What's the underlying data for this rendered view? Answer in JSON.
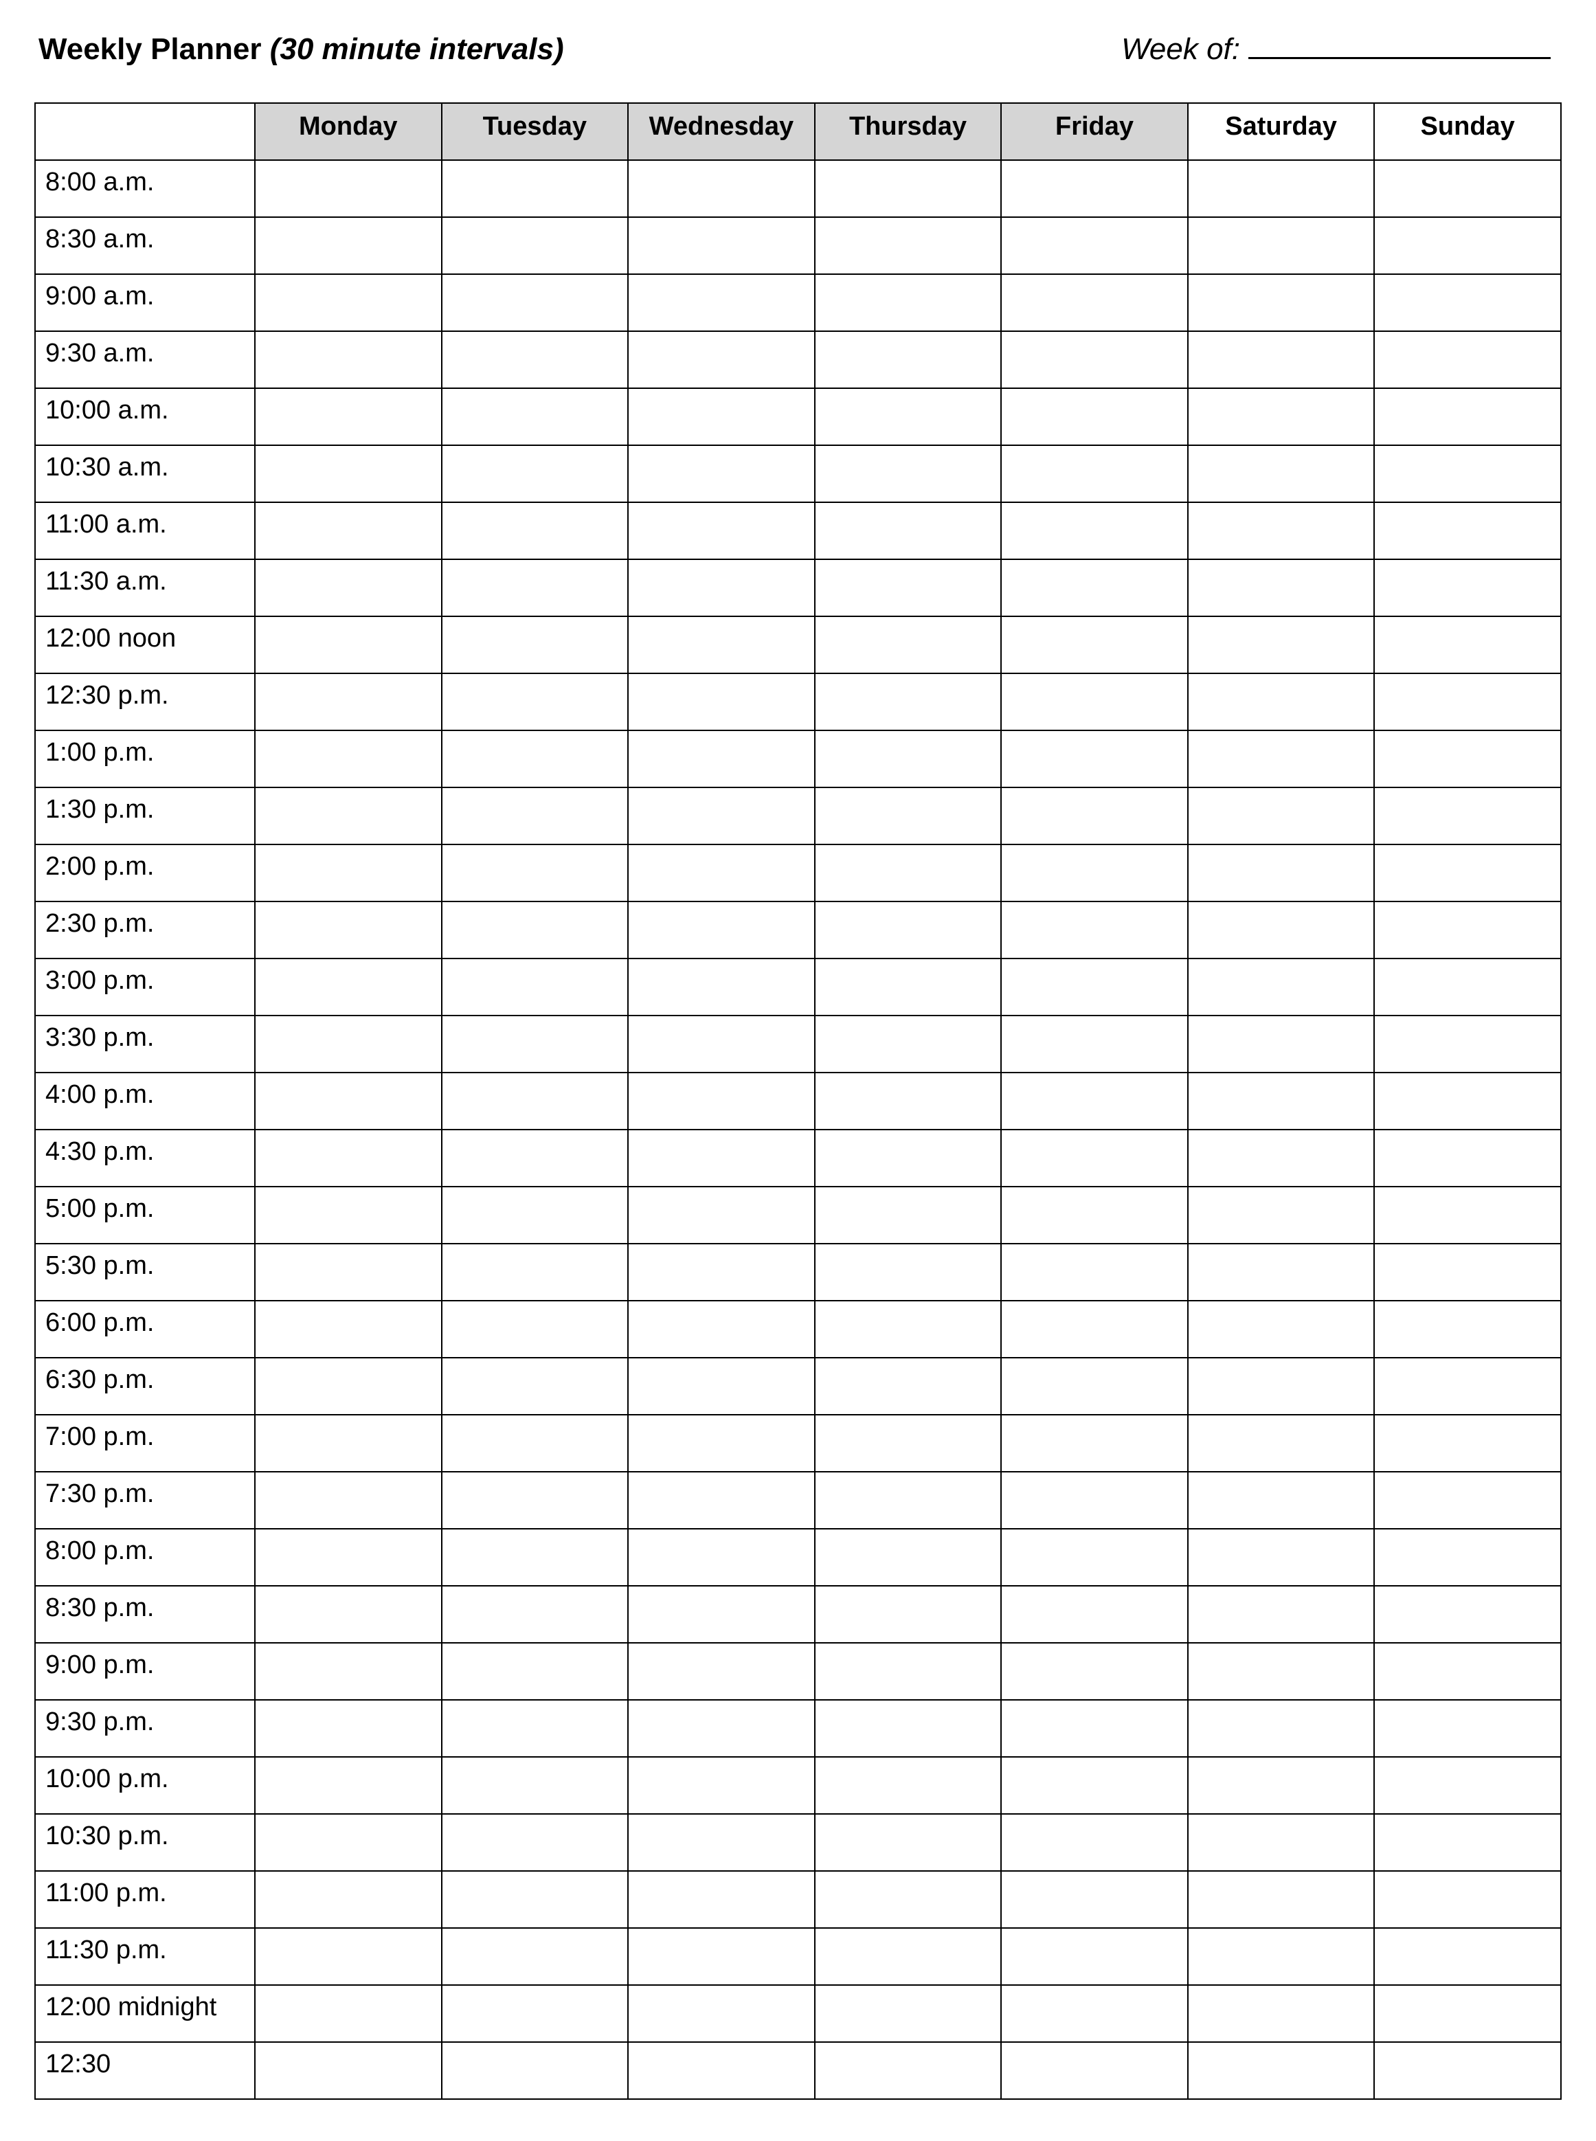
{
  "header": {
    "title_bold": "Weekly Planner",
    "title_italic": "(30 minute intervals)",
    "week_of_label": "Week of:",
    "week_of_value": ""
  },
  "columns": [
    {
      "label": "Monday",
      "shaded": true
    },
    {
      "label": "Tuesday",
      "shaded": true
    },
    {
      "label": "Wednesday",
      "shaded": true
    },
    {
      "label": "Thursday",
      "shaded": true
    },
    {
      "label": "Friday",
      "shaded": true
    },
    {
      "label": "Saturday",
      "shaded": false
    },
    {
      "label": "Sunday",
      "shaded": false
    }
  ],
  "times": [
    "8:00 a.m.",
    "8:30 a.m.",
    "9:00 a.m.",
    "9:30 a.m.",
    "10:00 a.m.",
    "10:30 a.m.",
    "11:00 a.m.",
    "11:30 a.m.",
    "12:00 noon",
    "12:30 p.m.",
    "1:00 p.m.",
    "1:30 p.m.",
    "2:00 p.m.",
    "2:30 p.m.",
    "3:00 p.m.",
    "3:30 p.m.",
    "4:00 p.m.",
    "4:30 p.m.",
    "5:00 p.m.",
    "5:30 p.m.",
    "6:00 p.m.",
    "6:30 p.m.",
    "7:00 p.m.",
    "7:30 p.m.",
    "8:00 p.m.",
    "8:30 p.m.",
    "9:00 p.m.",
    "9:30 p.m.",
    "10:00 p.m.",
    "10:30 p.m.",
    "11:00 p.m.",
    "11:30 p.m.",
    "12:00 midnight",
    "12:30"
  ]
}
